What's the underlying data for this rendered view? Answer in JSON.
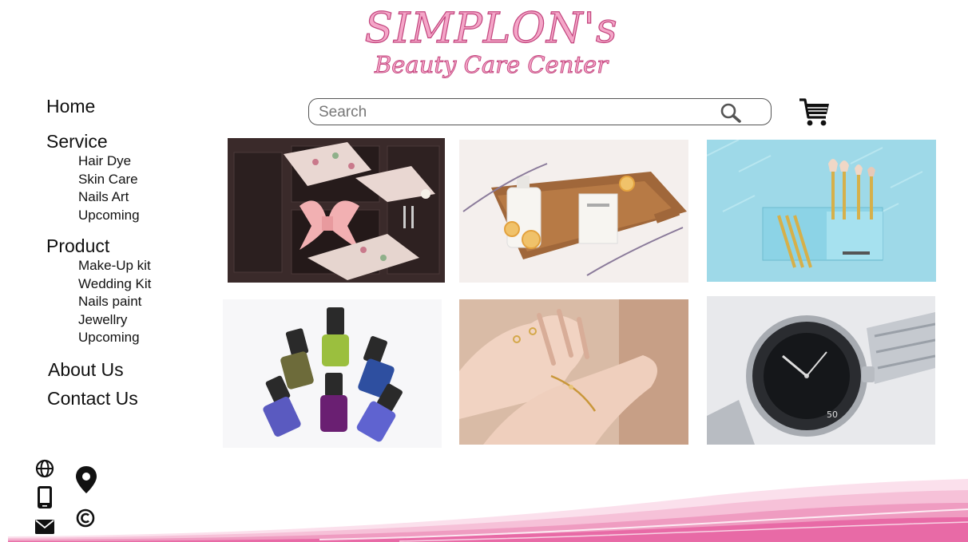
{
  "logo": {
    "line1": "SIMPLON's",
    "line2": "Beauty Care Center"
  },
  "nav": {
    "home": "Home",
    "service": {
      "label": "Service",
      "items": [
        "Hair Dye",
        "Skin Care",
        "Nails Art",
        "Upcoming"
      ]
    },
    "product": {
      "label": "Product",
      "items": [
        "Make-Up kit",
        "Wedding Kit",
        "Nails paint",
        "Jewellry",
        "Upcoming"
      ]
    },
    "about": "About Us",
    "contact": "Contact Us"
  },
  "search": {
    "placeholder": "Search",
    "value": ""
  },
  "icons": {
    "search": "search-icon",
    "cart": "cart-icon",
    "contact": [
      "globe-icon",
      "location-pin-icon",
      "phone-icon",
      "email-icon",
      "copyright-icon"
    ]
  },
  "gallery": [
    "wedding accessories box",
    "skin care products on board",
    "makeup brush set",
    "nail polish bottles",
    "jewellery on hands",
    "wrist watch"
  ],
  "colors": {
    "brand_pink": "#f4a6c8",
    "brand_pink_dark": "#c2447d",
    "wave_pink": "#e86aa6"
  }
}
